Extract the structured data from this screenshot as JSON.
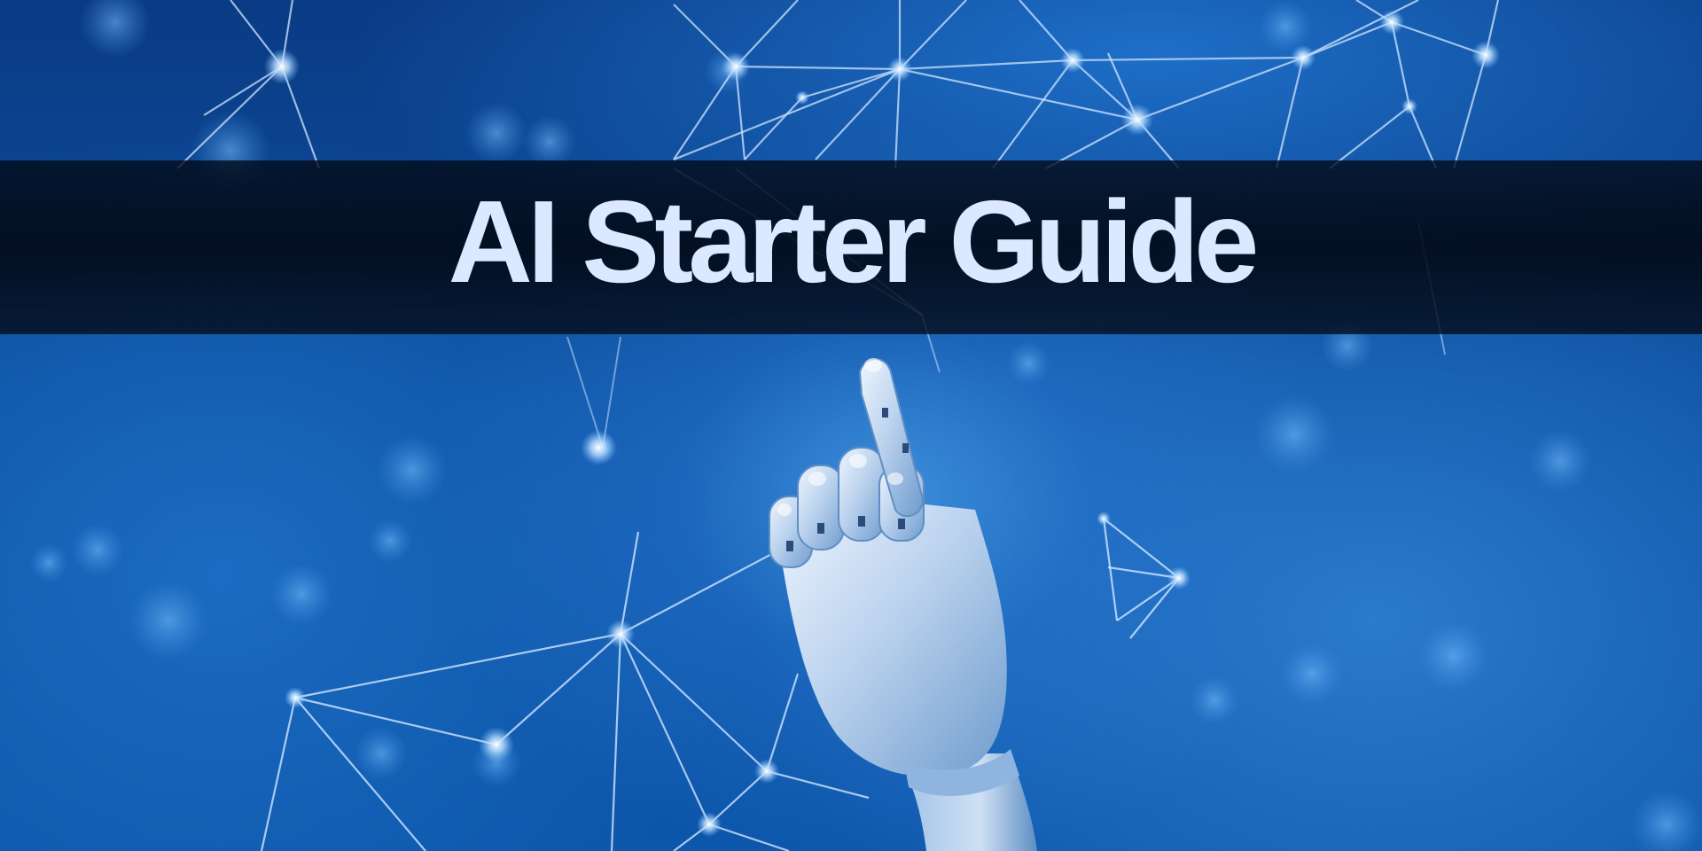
{
  "title": "AI Starter Guide",
  "colors": {
    "background": "#0c4a9a",
    "band": "#03091a",
    "title_text": "#dbe8ff",
    "network_lines": "#cfe6ff",
    "hand": "#d9e6f6"
  },
  "icons": {
    "network": "plexus-network-graphic",
    "hand": "robot-hand-graphic"
  }
}
